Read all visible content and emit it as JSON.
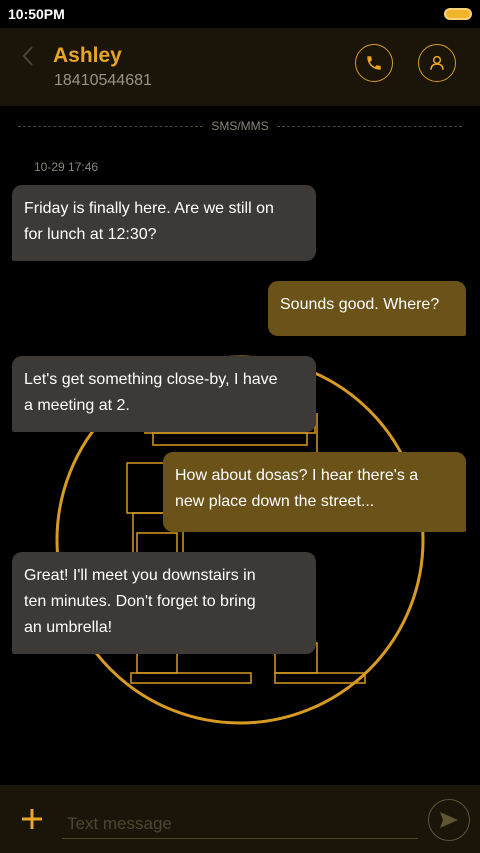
{
  "status_bar": {
    "time": "10:50PM"
  },
  "header": {
    "contact_name": "Ashley",
    "contact_number": "18410544681"
  },
  "thread": {
    "channel_label": "SMS/MMS",
    "timestamp": "10-29 17:46",
    "messages": [
      {
        "direction": "incoming",
        "lines": [
          "Friday is finally here. Are we still on",
          "for lunch at 12:30?"
        ]
      },
      {
        "direction": "outgoing",
        "lines": [
          "Sounds good. Where?"
        ]
      },
      {
        "direction": "incoming",
        "lines": [
          "Let's get something close-by, I have",
          "a meeting at 2."
        ]
      },
      {
        "direction": "outgoing",
        "lines": [
          "How about dosas? I hear there's a",
          "new place down the street..."
        ]
      },
      {
        "direction": "incoming",
        "lines": [
          "Great! I'll meet you downstairs in",
          "ten minutes. Don't forget to bring",
          "an umbrella!"
        ]
      }
    ]
  },
  "composer": {
    "placeholder": "Text message"
  },
  "icons": {
    "back": "back-chevron-icon",
    "call": "phone-icon",
    "profile": "person-icon",
    "add": "plus-icon",
    "send": "send-icon"
  },
  "colors": {
    "accent": "#e8a526",
    "incoming_bubble": "#3c3936",
    "outgoing_bubble": "#6b5218",
    "background": "#000000"
  }
}
